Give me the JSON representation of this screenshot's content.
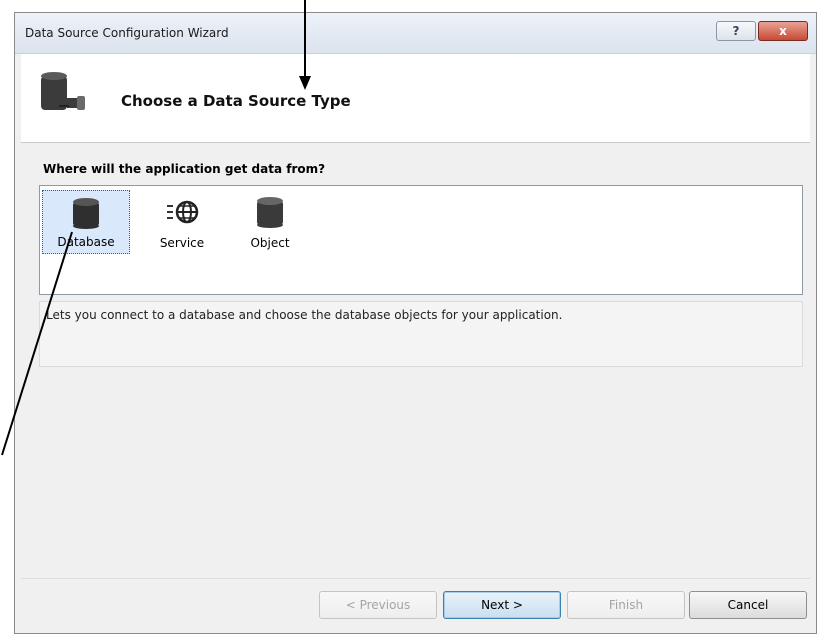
{
  "window": {
    "title": "Data Source Configuration Wizard",
    "help_glyph": "?",
    "close_glyph": "x"
  },
  "header": {
    "heading": "Choose a Data Source Type",
    "icon": "database-plug-icon"
  },
  "prompt": "Where will the application get data from?",
  "sources": [
    {
      "label": "Database",
      "icon": "database-icon",
      "selected": true
    },
    {
      "label": "Service",
      "icon": "globe-service-icon",
      "selected": false
    },
    {
      "label": "Object",
      "icon": "object-cylinder-icon",
      "selected": false
    }
  ],
  "description": "Lets you connect to a database and choose the database objects for your application.",
  "buttons": {
    "previous": "< Previous",
    "next": "Next >",
    "finish": "Finish",
    "cancel": "Cancel"
  },
  "colors": {
    "selection": "#d9e8fb",
    "close_button": "#c74a35"
  }
}
